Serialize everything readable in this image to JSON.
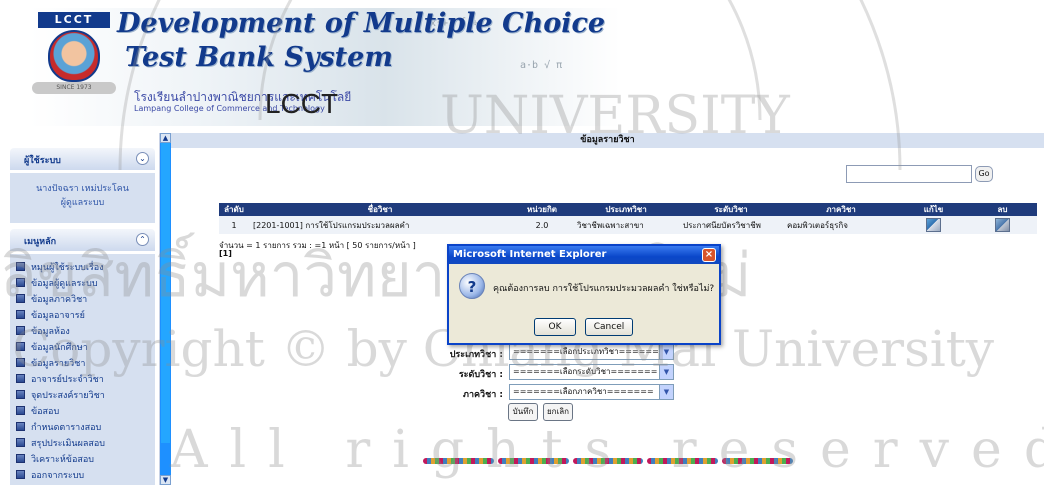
{
  "header": {
    "logo_text": "LCCT",
    "logo_ribbon": "SINCE 1973",
    "title_line1": "Development of Multiple Choice",
    "title_line2": "Test Bank System",
    "school_thai": "โรงเรียนลำปางพาณิชยการและเทคโนโลยี",
    "school_english": "Lampang College of Commerce and Technology",
    "school_abbr": "LCCT"
  },
  "sidebar": {
    "user_panel": {
      "title": "ผู้ใช้ระบบ",
      "toggle": "⌄",
      "name": "นางปัจฉรา เหม่ประโคน",
      "role": "ผู้ดูแลระบบ"
    },
    "menu_panel": {
      "title": "เมนูหลัก",
      "toggle": "⌃",
      "items": [
        "หมุนผู้ใช้ระบบเรื่อง",
        "ข้อมูลผู้ดูแลระบบ",
        "ข้อมูลภาควิชา",
        "ข้อมูลอาจารย์",
        "ข้อมูลห้อง",
        "ข้อมูลนักศึกษา",
        "ข้อมูลรายวิชา",
        "อาจารย์ประจำวิชา",
        "จุดประสงค์รายวิชา",
        "ข้อสอบ",
        "กำหนดตารางสอบ",
        "สรุปประเมินผลสอบ",
        "วิเคราะห์ข้อสอบ",
        "ออกจากระบบ"
      ]
    }
  },
  "main": {
    "page_title": "ข้อมูลรายวิชา",
    "search": {
      "value": "",
      "go_label": "Go"
    },
    "table": {
      "headers": [
        "ลำดับ",
        "ชื่อวิชา",
        "หน่วยกิต",
        "ประเภทวิชา",
        "ระดับวิชา",
        "ภาควิชา",
        "แก้ไข",
        "ลบ"
      ],
      "rows": [
        [
          "1",
          "[2201-1001] การใช้โปรแกรมประมวลผลคำ",
          "2.0",
          "วิชาชีพเฉพาะสาขา",
          "ประกาศนียบัตรวิชาชีพ",
          "คอมพิวเตอร์ธุรกิจ"
        ]
      ]
    },
    "summary": "จำนวน = 1 รายการ รวม : =1 หน้า [ 50 รายการ/หน้า ]",
    "page_number": "[1]",
    "form": {
      "type_label": "ประเภทวิชา :",
      "type_value": "=======เลือกประเภทวิชา=======",
      "level_label": "ระดับวิชา :",
      "level_value": "=======เลือกระดับวิชา=======",
      "dept_label": "ภาควิชา :",
      "dept_value": "=======เลือกภาควิชา=======",
      "save_label": "บันทึก",
      "cancel_label": "ยกเลิก"
    }
  },
  "dialog": {
    "title": "Microsoft Internet Explorer",
    "close": "×",
    "icon": "?",
    "message": "คุณต้องการลบ การใช้โปรแกรมประมวลผลคำ ใช่หรือไม่?",
    "ok_label": "OK",
    "cancel_label": "Cancel"
  },
  "watermark": {
    "line1": "ลิขสิทธิ์มหาวิทยาลัยเชียงใหม่",
    "line2": "Copyright © by Chiang Mai University",
    "line3": "All rights reserved",
    "arc_text": "UNIVERSITY"
  },
  "colors": {
    "accent": "#1f3b7c",
    "sidebar_scroll": "#1e90ff",
    "dialog_title": "#0a47c9"
  }
}
